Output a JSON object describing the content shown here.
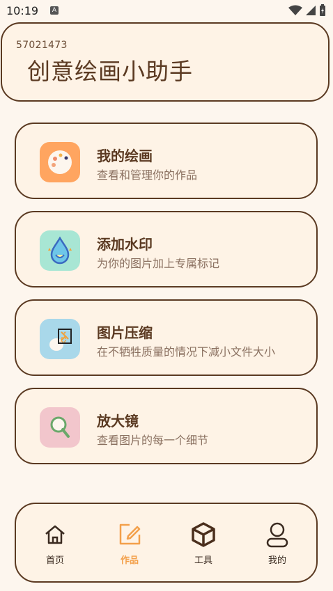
{
  "status_bar": {
    "time": "10:19",
    "notification_badge": "A"
  },
  "header": {
    "id": "57021473",
    "title": "创意绘画小助手"
  },
  "menu": [
    {
      "title": "我的绘画",
      "subtitle": "查看和管理你的作品",
      "icon": "palette-icon",
      "icon_bg": "#ffa560"
    },
    {
      "title": "添加水印",
      "subtitle": "为你的图片加上专属标记",
      "icon": "water-drop-icon",
      "icon_bg": "#a8e6d4"
    },
    {
      "title": "图片压缩",
      "subtitle": "在不牺牲质量的情况下减小文件大小",
      "icon": "compress-icon",
      "icon_bg": "#a9d8ea"
    },
    {
      "title": "放大镜",
      "subtitle": "查看图片的每一个细节",
      "icon": "magnifier-icon",
      "icon_bg": "#f2c6cc"
    }
  ],
  "bottom_nav": {
    "items": [
      {
        "label": "首页",
        "icon": "home-icon"
      },
      {
        "label": "作品",
        "icon": "edit-icon",
        "active": true
      },
      {
        "label": "工具",
        "icon": "cube-icon"
      },
      {
        "label": "我的",
        "icon": "person-icon"
      }
    ]
  },
  "colors": {
    "background": "#fdf6ee",
    "card": "#fef3e6",
    "border": "#5b3a22",
    "accent": "#f3a04a"
  }
}
